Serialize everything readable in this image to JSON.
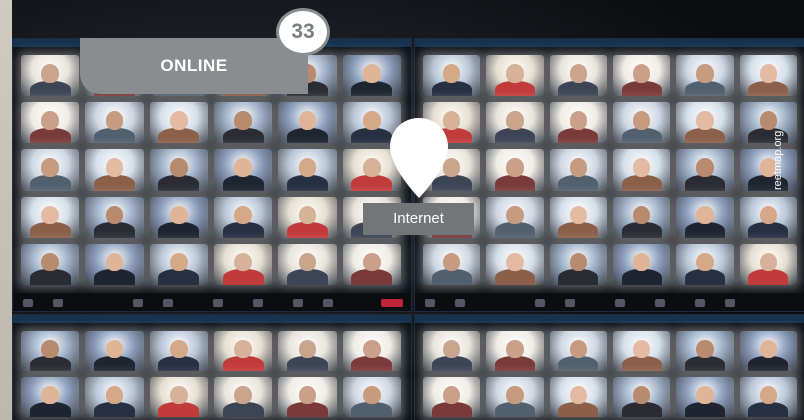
{
  "section_tab": {
    "label": "ONLINE"
  },
  "page_badge": {
    "number": "33"
  },
  "location_marker": {
    "label": "Internet",
    "icon": "map-pin-icon"
  },
  "photo_credit": {
    "text": "reetmap.org"
  },
  "colors": {
    "tab_gray": "#8a8d8f",
    "label_gray": "#727678",
    "window_titlebar": "#16324f",
    "leave_button": "#c0243b"
  },
  "tile_palettes": [
    [
      "#e9e4dc",
      "#c9a58e",
      "#3c4456"
    ],
    [
      "#d6dfe9",
      "#e3bba4",
      "#8b5f4a"
    ],
    [
      "#b9c7d8",
      "#d5a888",
      "#263042"
    ],
    [
      "#f0ece6",
      "#caa08a",
      "#7a3a3a"
    ],
    [
      "#9fb1c7",
      "#b88a6e",
      "#2b2b33"
    ],
    [
      "#e6e0d2",
      "#d6b29a",
      "#c23b3b"
    ],
    [
      "#cfd7e2",
      "#c79b80",
      "#51606f"
    ],
    [
      "#8ea0bd",
      "#e0b597",
      "#1f2530"
    ]
  ]
}
